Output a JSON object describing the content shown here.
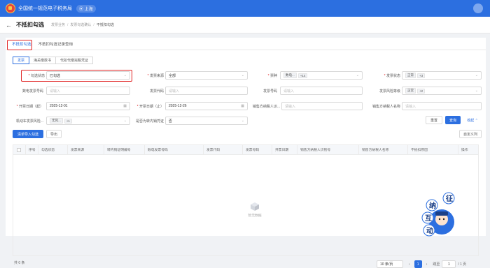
{
  "header": {
    "system_title": "全国统一规范电子税务局",
    "region": "上海"
  },
  "breadcrumb": {
    "back": "←",
    "page_title": "不抵扣勾选",
    "items": [
      "发票业务",
      "发票勾选确认",
      "不抵扣勾选"
    ],
    "separator": "/"
  },
  "top_tabs": [
    {
      "label": "不抵扣勾选",
      "active": true
    },
    {
      "label": "不抵扣勾选记录查询",
      "active": false
    }
  ],
  "sub_tabs": [
    {
      "label": "发票",
      "active": true
    },
    {
      "label": "海关缴款书",
      "active": false
    },
    {
      "label": "代扣代缴完税凭证",
      "active": false
    }
  ],
  "filters": {
    "select_status": {
      "label": "勾选状态",
      "value": "已勾选"
    },
    "invoice_source": {
      "label": "发票来源",
      "value": "全部"
    },
    "ticket_type": {
      "label": "票种",
      "chip": "数电...",
      "more": "+14"
    },
    "invoice_status": {
      "label": "发票状态",
      "chip": "正常",
      "more": "+3"
    },
    "digital_no": {
      "label": "数电发票号码",
      "placeholder": "请输入"
    },
    "invoice_code": {
      "label": "发票代码",
      "placeholder": "请输入"
    },
    "invoice_no": {
      "label": "发票号码",
      "placeholder": "请输入"
    },
    "risk_level": {
      "label": "发票风险等级",
      "chip": "正常",
      "more": "+2"
    },
    "date_start": {
      "label": "开票日期（起）",
      "value": "2025-12-01"
    },
    "date_end": {
      "label": "开票日期（止）",
      "value": "2025-12-26"
    },
    "seller_id": {
      "label": "销售方纳税人识...",
      "placeholder": "请输入"
    },
    "seller_name": {
      "label": "销售方纳税人名称",
      "placeholder": "请输入"
    },
    "vehicle_risk": {
      "label": "机动车发票风险...",
      "chip": "无风...",
      "more": "+1"
    },
    "inner_voucher": {
      "label": "是否为转内销凭证",
      "value": "否"
    }
  },
  "buttons": {
    "reset": "重置",
    "query": "查询",
    "collapse": "收起 ⌃",
    "batch_import": "清单导入勾选",
    "export": "导出",
    "custom_columns": "自定义列"
  },
  "table": {
    "columns": [
      "",
      "序号",
      "勾选状态",
      "发票来源",
      "转内销证明编号",
      "数电发票号码",
      "发票代码",
      "发票号码",
      "开票日期",
      "销售方纳税人识别号",
      "销售方纳税人名称",
      "不抵扣原因",
      "操作"
    ],
    "empty_text": "暂无数据"
  },
  "mascot": {
    "chars": [
      "征",
      "纳",
      "互",
      "动"
    ]
  },
  "pagination": {
    "total": "共 0 条",
    "page_size": "10 条/页",
    "current_page": "1",
    "goto_label": "跳至",
    "goto_value": "1",
    "total_pages": "/ 1 页",
    "prev": "‹",
    "next": "›"
  },
  "colors": {
    "primary": "#2c6fe0",
    "highlight": "#e02020"
  }
}
